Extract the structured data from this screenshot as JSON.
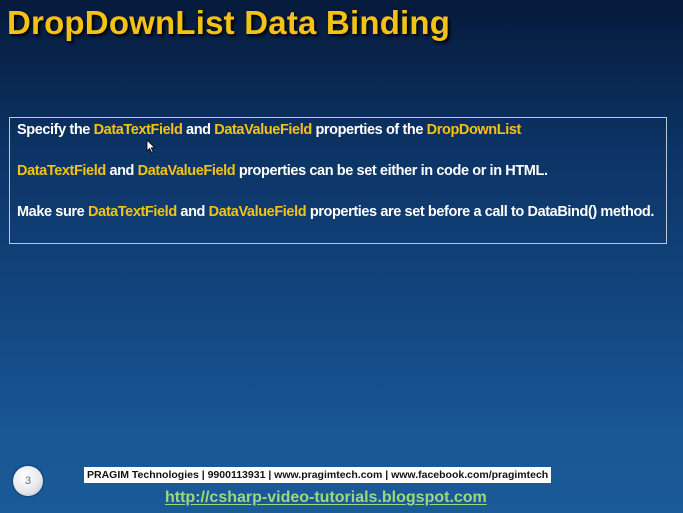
{
  "slide": {
    "title": "DropDownList Data Binding"
  },
  "content": {
    "line1": {
      "t1": "Specify the ",
      "kw1": "DataTextField",
      "t2": " and ",
      "kw2": "DataValueField",
      "t3": " properties of the ",
      "kw3": "DropDownList"
    },
    "line2": {
      "kw1": "DataTextField",
      "t1": " and ",
      "kw2": "DataValueField",
      "t2": " properties can be set either in code or in HTML."
    },
    "line3": {
      "t1": "Make sure ",
      "kw1": "DataTextField",
      "t2": " and ",
      "kw2": "DataValueField",
      "t3": " properties  are set before a call to DataBind() method."
    }
  },
  "footer": {
    "slide_number": "3",
    "contact": "PRAGIM Technologies | 9900113931 | www.pragimtech.com | www.facebook.com/pragimtech",
    "url": "http://csharp-video-tutorials.blogspot.com"
  },
  "colors": {
    "title": "#f4c214",
    "keyword": "#f4c214",
    "body_text": "#ffffff",
    "url": "#9fd77d",
    "background_top": "#061a3b",
    "background_bottom": "#1b5a98"
  },
  "icons": {
    "cursor": "mouse-pointer-icon"
  }
}
